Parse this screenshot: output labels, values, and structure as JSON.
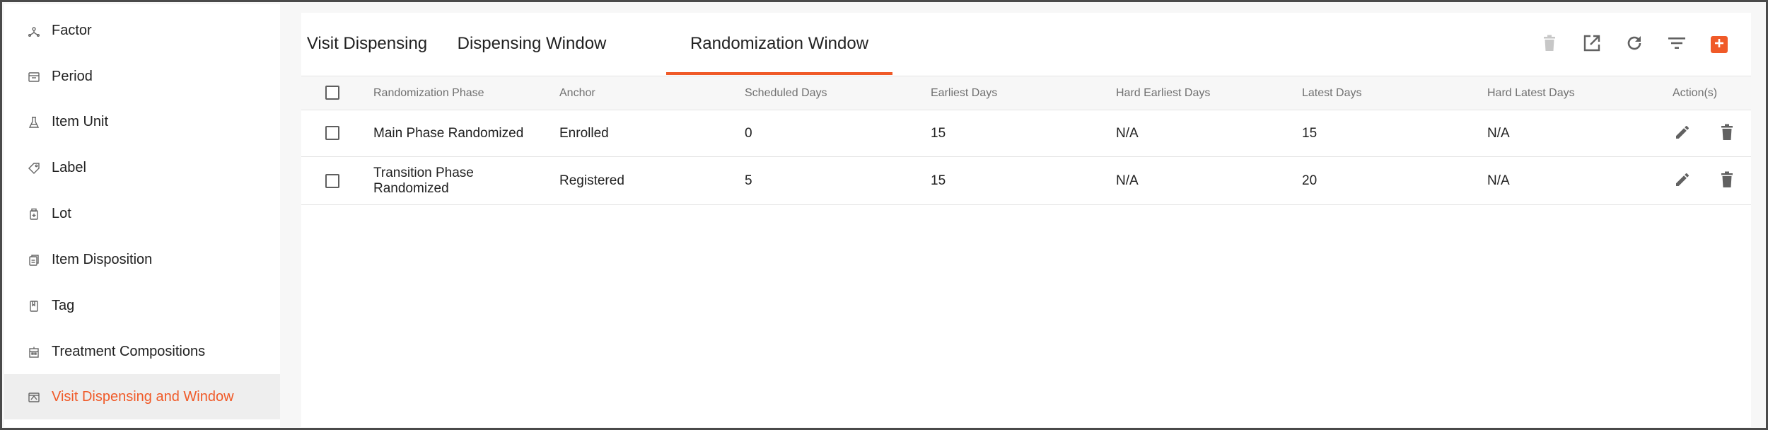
{
  "sidebar": {
    "items": [
      {
        "label": "Factor",
        "icon": "factor-icon"
      },
      {
        "label": "Period",
        "icon": "period-icon"
      },
      {
        "label": "Item Unit",
        "icon": "flask-icon"
      },
      {
        "label": "Label",
        "icon": "tag-label-icon"
      },
      {
        "label": "Lot",
        "icon": "lot-icon"
      },
      {
        "label": "Item Disposition",
        "icon": "document-icon"
      },
      {
        "label": "Tag",
        "icon": "bookmark-icon"
      },
      {
        "label": "Treatment Compositions",
        "icon": "building-icon"
      },
      {
        "label": "Visit Dispensing and Window",
        "icon": "calendar-icon",
        "active": true
      }
    ]
  },
  "tabs": [
    {
      "label": "Visit Dispensing"
    },
    {
      "label": "Dispensing Window"
    },
    {
      "label": "Randomization Window",
      "active": true
    }
  ],
  "toolbar": {
    "icons": [
      "delete-icon",
      "open-external-icon",
      "refresh-icon",
      "filter-icon",
      "add-icon"
    ]
  },
  "table": {
    "columns": [
      "Randomization Phase",
      "Anchor",
      "Scheduled Days",
      "Earliest Days",
      "Hard Earliest Days",
      "Latest Days",
      "Hard Latest Days",
      "Action(s)"
    ],
    "rows": [
      {
        "phase": "Main Phase Randomized",
        "anchor": "Enrolled",
        "scheduled": "0",
        "earliest": "15",
        "hard_earliest": "N/A",
        "latest": "15",
        "hard_latest": "N/A"
      },
      {
        "phase": "Transition Phase Randomized",
        "anchor": "Registered",
        "scheduled": "5",
        "earliest": "15",
        "hard_earliest": "N/A",
        "latest": "20",
        "hard_latest": "N/A"
      }
    ]
  },
  "colors": {
    "accent": "#f05a28",
    "text": "#212121",
    "muted": "#707070",
    "icon": "#616161",
    "disabled_icon": "#c7c7c7"
  }
}
